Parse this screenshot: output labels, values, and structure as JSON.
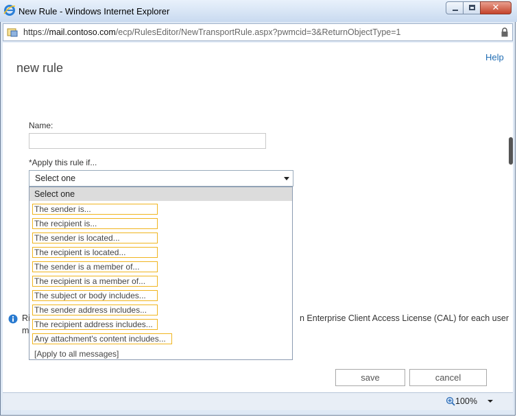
{
  "window": {
    "title": "New Rule - Windows Internet Explorer",
    "close_glyph": "✕"
  },
  "address": {
    "protocol": "https://",
    "domain": "mail.contoso.com",
    "path": "/ecp/RulesEditor/NewTransportRule.aspx?pwmcid=3&ReturnObjectType=1"
  },
  "page": {
    "help": "Help",
    "title": "new rule",
    "name_label": "Name:",
    "name_value": "",
    "apply_label": "*Apply this rule if...",
    "select_value": "Select one"
  },
  "dropdown": {
    "selected": "Select one",
    "options": [
      "The sender is...",
      "The recipient is...",
      "The sender is located...",
      "The recipient is located...",
      "The sender is a member of...",
      "The recipient is a member of...",
      "The subject or body includes...",
      "The sender address includes...",
      "The recipient address includes...",
      "Any attachment's content includes..."
    ],
    "last": "[Apply to all messages]"
  },
  "info": {
    "left_line1": "Ri",
    "left_line2": "m",
    "right_line1": "n Enterprise Client Access License (CAL) for each user",
    "right_line2": ""
  },
  "buttons": {
    "save": "save",
    "cancel": "cancel"
  },
  "status": {
    "zoom": "100%"
  },
  "colors": {
    "option_border": "#f0b41d",
    "link": "#1f6cb3"
  }
}
